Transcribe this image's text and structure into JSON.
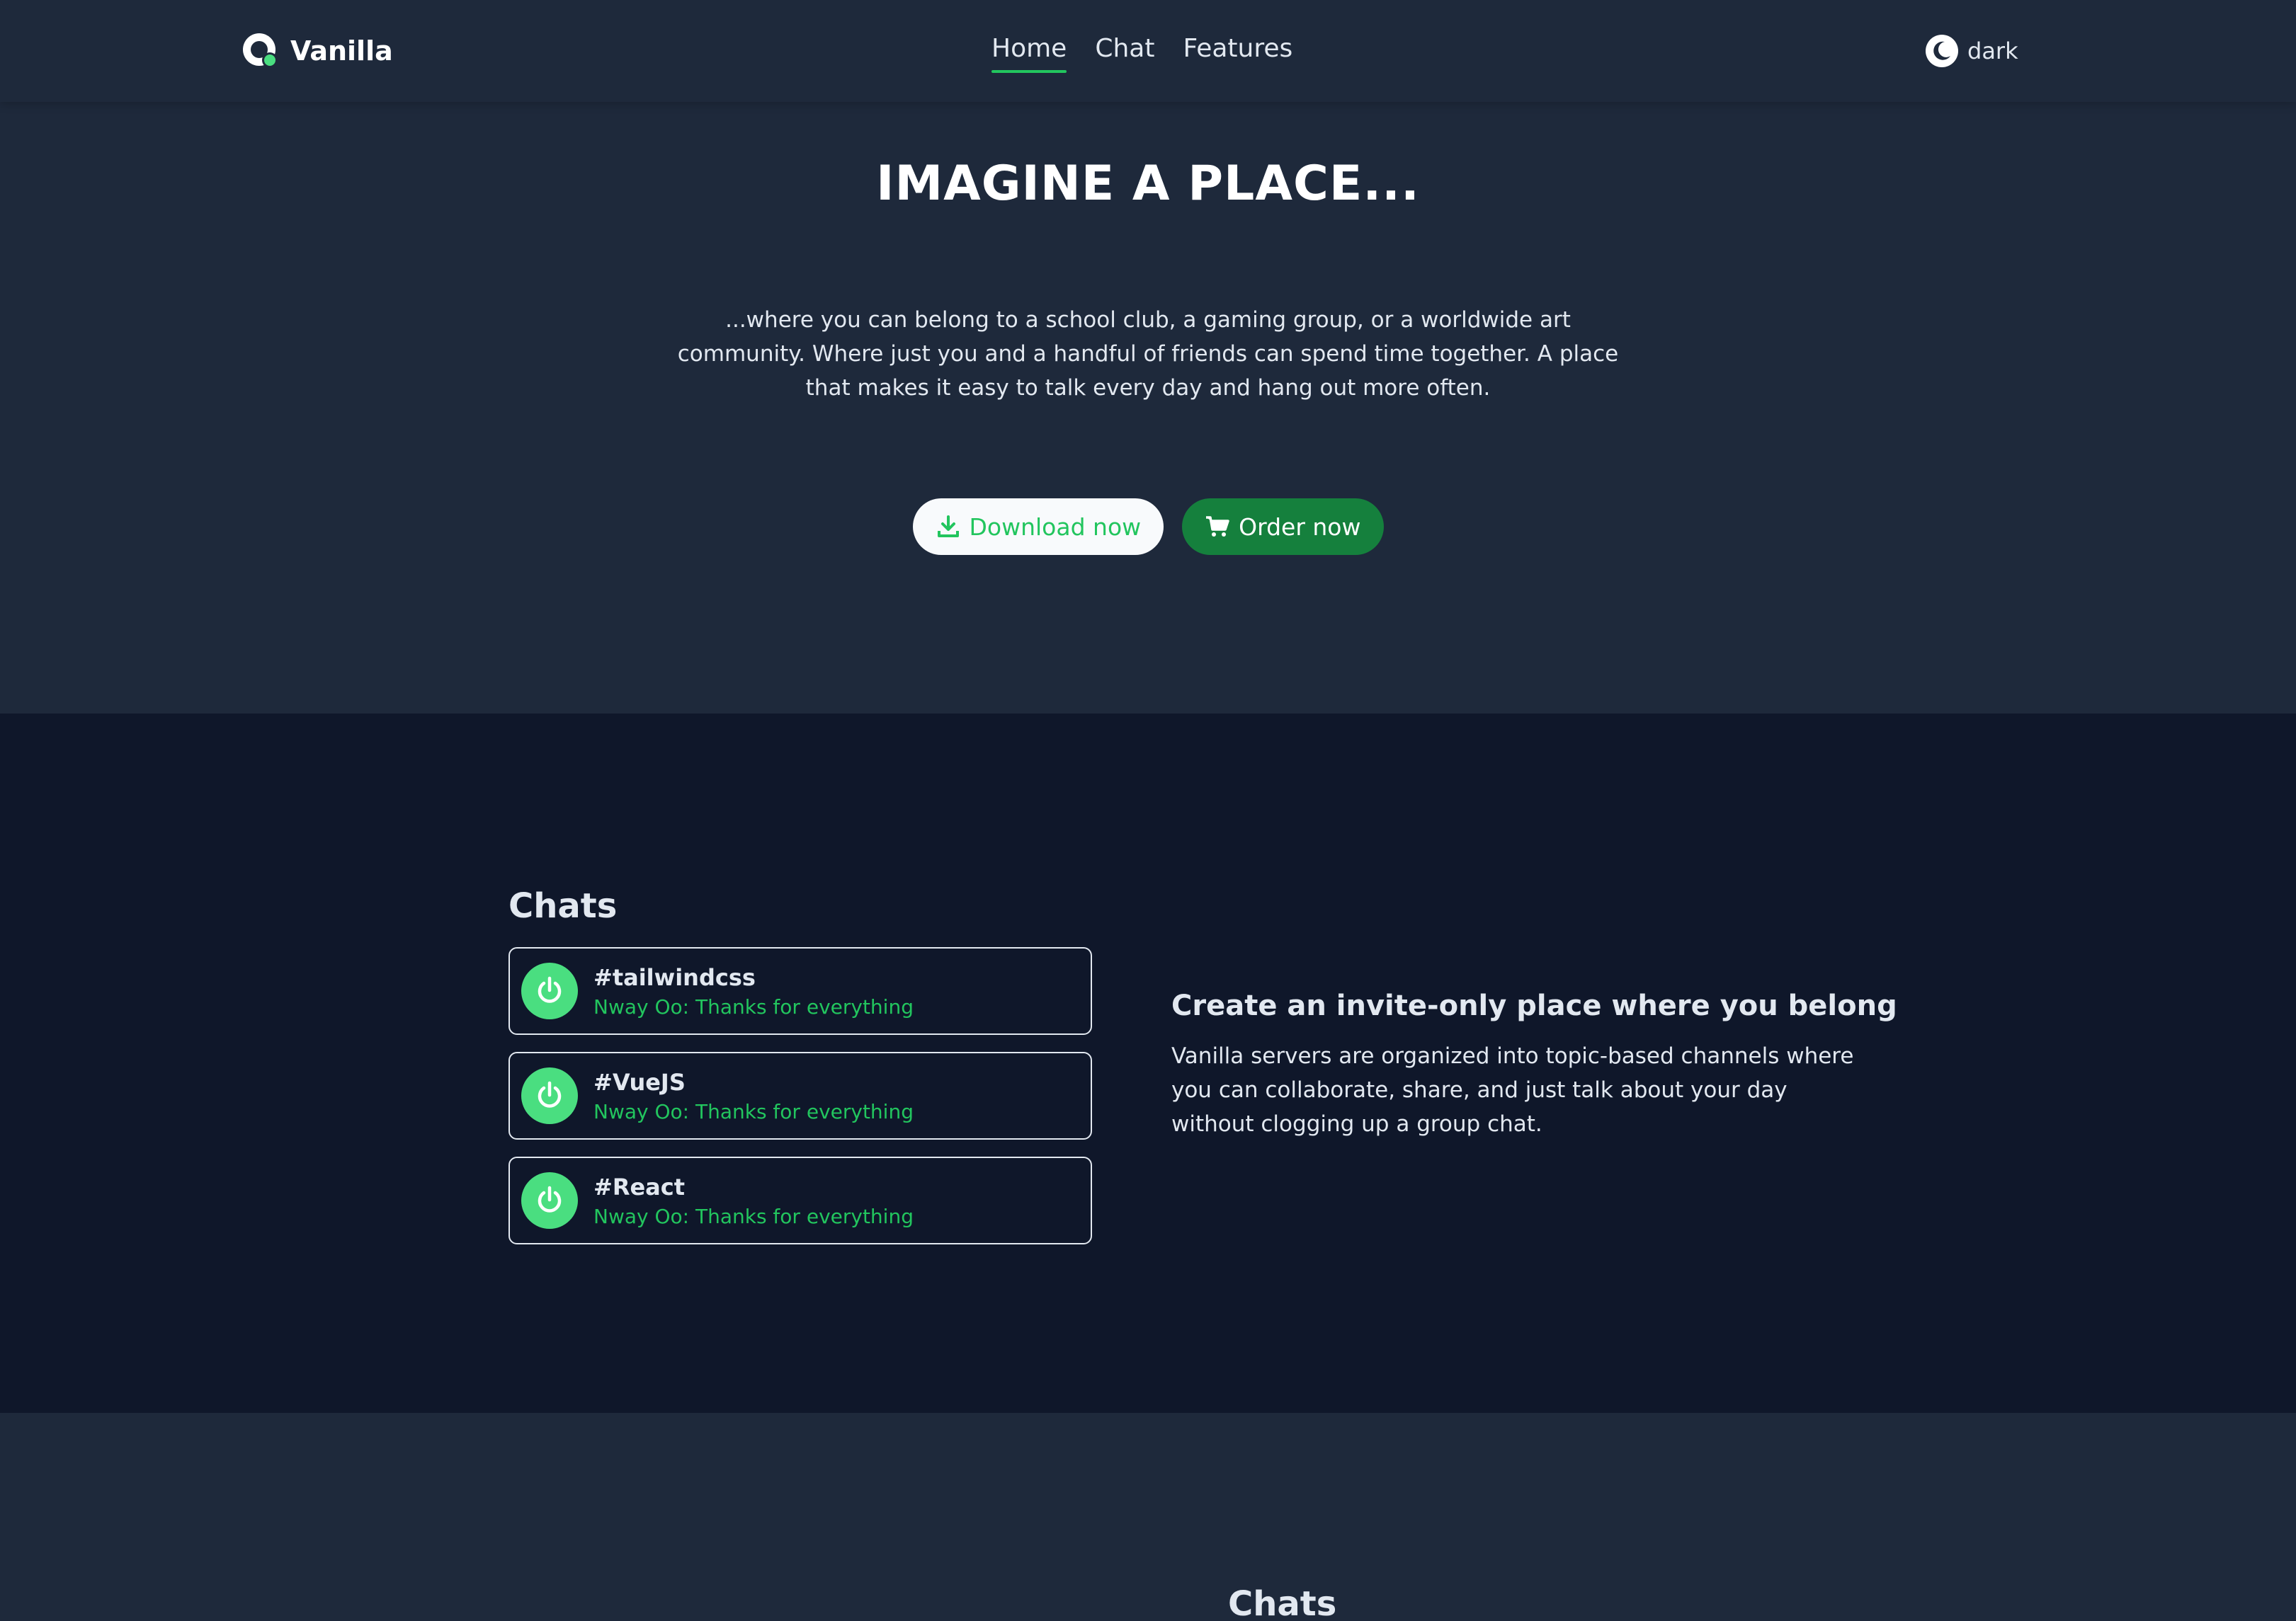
{
  "nav": {
    "brand": "Vanilla",
    "links": [
      {
        "label": "Home",
        "active": true
      },
      {
        "label": "Chat",
        "active": false
      },
      {
        "label": "Features",
        "active": false
      }
    ],
    "theme_label": "dark"
  },
  "hero": {
    "title": "IMAGINE A PLACE...",
    "description": "...where you can belong to a school club, a gaming group, or a worldwide art community. Where just you and a handful of friends can spend time together. A place that makes it easy to talk every day and hang out more often.",
    "download_label": "Download now",
    "order_label": "Order now"
  },
  "chats": {
    "title": "Chats",
    "items": [
      {
        "name": "#tailwindcss",
        "message": "Nway Oo: Thanks for everything"
      },
      {
        "name": "#VueJS",
        "message": "Nway Oo: Thanks for everything"
      },
      {
        "name": "#React",
        "message": "Nway Oo: Thanks for everything"
      }
    ]
  },
  "feature": {
    "title": "Create an invite-only place where you belong",
    "description": "Vanilla servers are organized into topic-based channels where you can collaborate, share, and just talk about your day without clogging up a group chat."
  },
  "bottom": {
    "title": "Chats"
  },
  "colors": {
    "accent": "#22c55e",
    "accent_dark": "#15803d",
    "bg": "#1e293b",
    "bg_dark": "#0f172a"
  }
}
